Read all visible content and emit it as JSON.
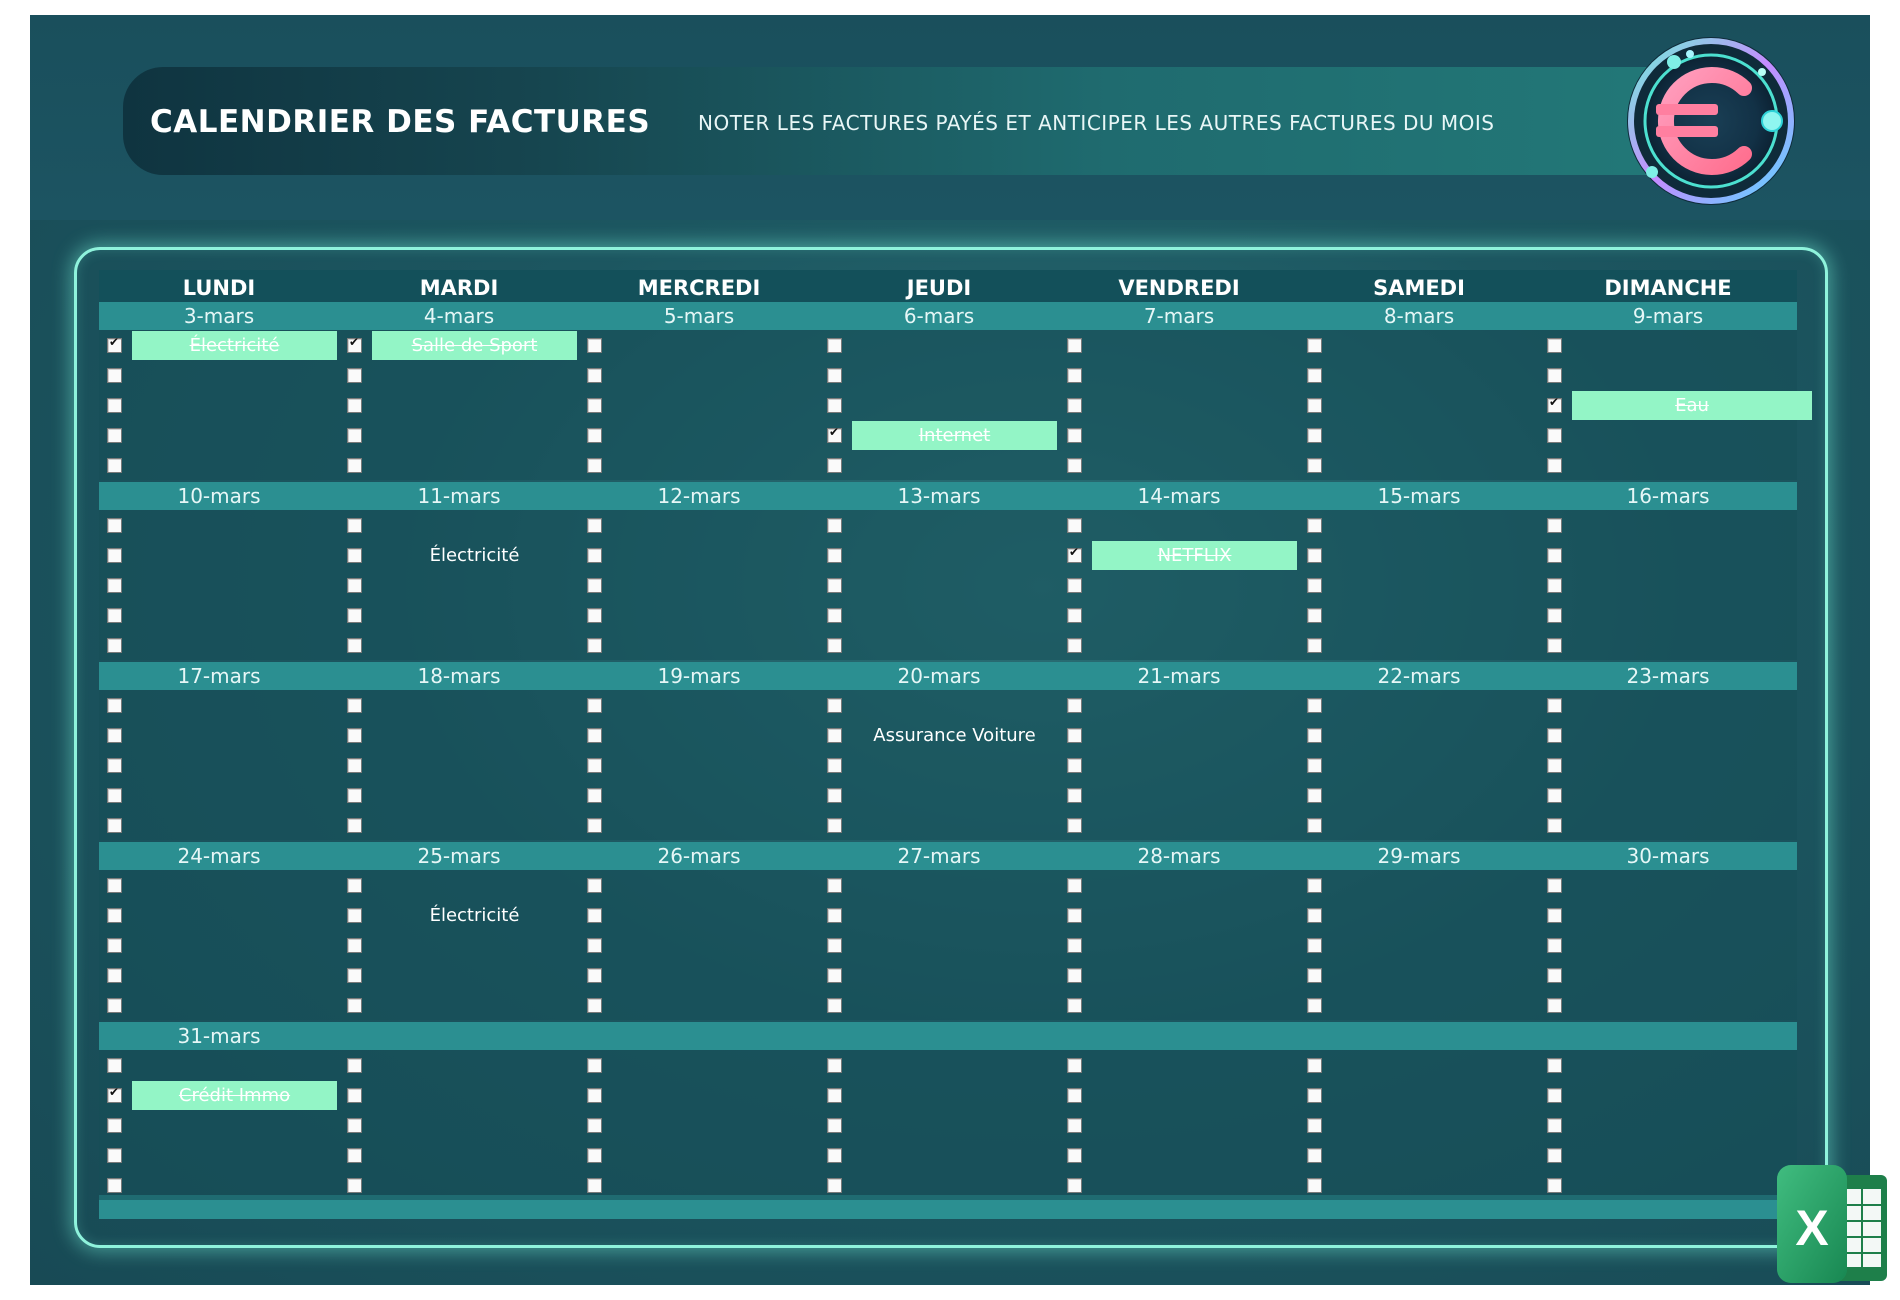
{
  "header": {
    "title": "CALENDRIER DES FACTURES",
    "subtitle": "NOTER LES FACTURES PAYÉS ET ANTICIPER LES AUTRES FACTURES DU  MOIS"
  },
  "colors": {
    "background": "#184a55",
    "date_row": "#2b8f91",
    "paid_highlight": "#93f5c6",
    "glow_border": "#8ff3dc"
  },
  "icons": {
    "logo": "euro-coin-icon",
    "app": "excel-icon"
  },
  "calendar": {
    "days_of_week": [
      "LUNDI",
      "MARDI",
      "MERCREDI",
      "JEUDI",
      "VENDREDI",
      "SAMEDI",
      "DIMANCHE"
    ],
    "weeks": [
      {
        "dates": [
          "3-mars",
          "4-mars",
          "5-mars",
          "6-mars",
          "7-mars",
          "8-mars",
          "9-mars"
        ],
        "bills": [
          {
            "day": 0,
            "slot": 0,
            "label": "Électricité",
            "paid": true
          },
          {
            "day": 1,
            "slot": 0,
            "label": "Salle de Sport",
            "paid": true
          },
          {
            "day": 3,
            "slot": 3,
            "label": "Internet",
            "paid": true
          },
          {
            "day": 6,
            "slot": 2,
            "label": "Eau",
            "paid": true
          }
        ]
      },
      {
        "dates": [
          "10-mars",
          "11-mars",
          "12-mars",
          "13-mars",
          "14-mars",
          "15-mars",
          "16-mars"
        ],
        "bills": [
          {
            "day": 1,
            "slot": 1,
            "label": "Électricité",
            "paid": false
          },
          {
            "day": 4,
            "slot": 1,
            "label": "NETFLIX",
            "paid": true
          }
        ]
      },
      {
        "dates": [
          "17-mars",
          "18-mars",
          "19-mars",
          "20-mars",
          "21-mars",
          "22-mars",
          "23-mars"
        ],
        "bills": [
          {
            "day": 3,
            "slot": 1,
            "label": "Assurance Voiture",
            "paid": false
          }
        ]
      },
      {
        "dates": [
          "24-mars",
          "25-mars",
          "26-mars",
          "27-mars",
          "28-mars",
          "29-mars",
          "30-mars"
        ],
        "bills": [
          {
            "day": 1,
            "slot": 1,
            "label": "Électricité",
            "paid": false
          }
        ]
      },
      {
        "dates": [
          "31-mars",
          "",
          "",
          "",
          "",
          "",
          ""
        ],
        "bills": [
          {
            "day": 0,
            "slot": 1,
            "label": "Crédit Immo",
            "paid": true
          }
        ]
      }
    ]
  }
}
